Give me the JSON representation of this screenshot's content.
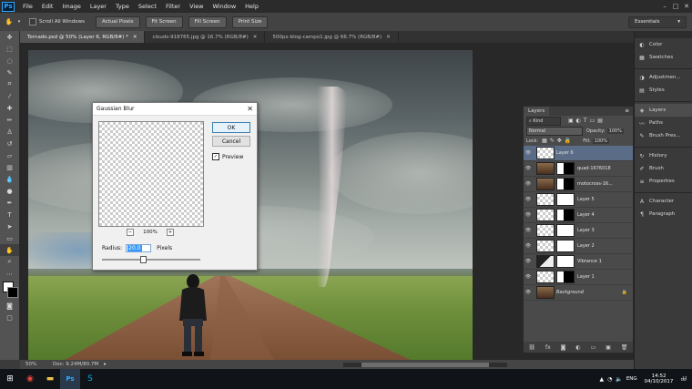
{
  "app": {
    "logo": "Ps"
  },
  "menu": [
    "File",
    "Edit",
    "Image",
    "Layer",
    "Type",
    "Select",
    "Filter",
    "View",
    "Window",
    "Help"
  ],
  "window_controls": [
    "–",
    "□",
    "✕"
  ],
  "options": {
    "scroll_all": "Scroll All Windows",
    "buttons": [
      "Actual Pixels",
      "Fit Screen",
      "Fill Screen",
      "Print Size"
    ],
    "workspace": "Essentials"
  },
  "tabs": [
    {
      "label": "Tornado.psd @ 50% (Layer 6, RGB/8#) *",
      "active": true
    },
    {
      "label": "clouds-918765.jpg @ 16.7% (RGB/8#)",
      "active": false
    },
    {
      "label": "500px-blog-campo1.jpg @ 66.7% (RGB/8#)",
      "active": false
    }
  ],
  "status": {
    "zoom": "50%",
    "doc": "Doc: 9.24M/80.7M"
  },
  "dialog": {
    "title": "Gaussian Blur",
    "ok": "OK",
    "cancel": "Cancel",
    "preview": "Preview",
    "zoom": "100%",
    "radius_label": "Radius:",
    "radius_value": "20.0",
    "radius_unit": "Pixels",
    "slider_level": 0.42
  },
  "dock": [
    {
      "icon": "color-icon",
      "glyph": "◐",
      "label": "Color"
    },
    {
      "icon": "swatches-icon",
      "glyph": "▦",
      "label": "Swatches"
    },
    {
      "icon": "adjustments-icon",
      "glyph": "◑",
      "label": "Adjustmen..."
    },
    {
      "icon": "styles-icon",
      "glyph": "▤",
      "label": "Styles"
    },
    {
      "icon": "layers-icon",
      "glyph": "◈",
      "label": "Layers"
    },
    {
      "icon": "paths-icon",
      "glyph": "〰",
      "label": "Paths"
    },
    {
      "icon": "brush-presets-icon",
      "glyph": "✎",
      "label": "Brush Pres..."
    },
    {
      "icon": "history-icon",
      "glyph": "↻",
      "label": "History"
    },
    {
      "icon": "brush-icon",
      "glyph": "✐",
      "label": "Brush"
    },
    {
      "icon": "properties-icon",
      "glyph": "≡",
      "label": "Properties"
    },
    {
      "icon": "character-icon",
      "glyph": "A",
      "label": "Character"
    },
    {
      "icon": "paragraph-icon",
      "glyph": "¶",
      "label": "Paragraph"
    }
  ],
  "layers_panel": {
    "title": "Layers",
    "kind": "Kind",
    "blend_mode": "Normal",
    "opacity_label": "Opacity:",
    "opacity": "100%",
    "lock_label": "Lock:",
    "fill_label": "Fill:",
    "fill": "100%",
    "layers": [
      {
        "name": "Layer 6",
        "selected": true,
        "thumb": "checker",
        "mask": false
      },
      {
        "name": "quad-1676018",
        "selected": false,
        "thumb": "photo",
        "mask": "dark"
      },
      {
        "name": "motocross-16...",
        "selected": false,
        "thumb": "photo",
        "mask": "dark"
      },
      {
        "name": "Layer 5",
        "selected": false,
        "thumb": "checker",
        "mask": true
      },
      {
        "name": "Layer 4",
        "selected": false,
        "thumb": "checker",
        "mask": "dark"
      },
      {
        "name": "Layer 3",
        "selected": false,
        "thumb": "checker",
        "mask": true
      },
      {
        "name": "Layer 2",
        "selected": false,
        "thumb": "checker",
        "mask": true
      },
      {
        "name": "Vibrance 1",
        "selected": false,
        "thumb": "adjust",
        "mask": true
      },
      {
        "name": "Layer 1",
        "selected": false,
        "thumb": "checker",
        "mask": "dark"
      },
      {
        "name": "Background",
        "selected": false,
        "thumb": "photo",
        "mask": false
      }
    ],
    "footer_icons": [
      "⛓",
      "fx",
      "◙",
      "◐",
      "▭",
      "▣",
      "🗑"
    ]
  },
  "taskbar": {
    "apps": [
      {
        "icon": "windows-start-icon",
        "glyph": "⊞",
        "color": "#ffffff"
      },
      {
        "icon": "chrome-icon",
        "glyph": "◉",
        "color": "#e8453c"
      },
      {
        "icon": "file-explorer-icon",
        "glyph": "▬",
        "color": "#f2c14e"
      },
      {
        "icon": "photoshop-icon",
        "glyph": "Ps",
        "color": "#31a8ff"
      },
      {
        "icon": "skype-icon",
        "glyph": "S",
        "color": "#00aff0"
      }
    ],
    "lang": "ENG",
    "time": "14:52",
    "date": "04/10/2017",
    "notif": "17"
  }
}
